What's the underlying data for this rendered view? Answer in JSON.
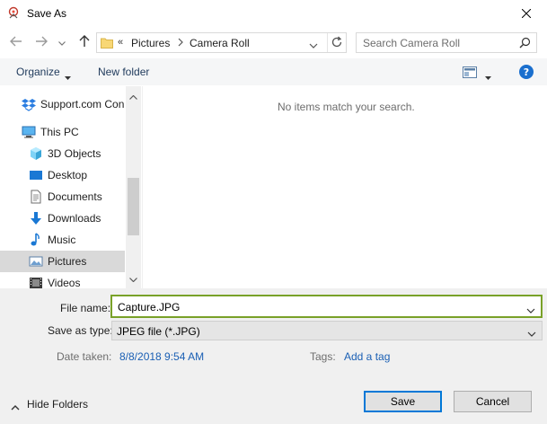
{
  "window": {
    "title": "Save As"
  },
  "address": {
    "overflow": "«",
    "parts": [
      "Pictures",
      "Camera Roll"
    ]
  },
  "search": {
    "placeholder": "Search Camera Roll"
  },
  "commands": {
    "organize": "Organize",
    "new_folder": "New folder"
  },
  "tree": [
    {
      "label": "Support.com Con",
      "icon": "dropbox-icon"
    },
    {
      "label": "This PC",
      "icon": "computer-icon"
    },
    {
      "label": "3D Objects",
      "icon": "cube-icon"
    },
    {
      "label": "Desktop",
      "icon": "desktop-icon"
    },
    {
      "label": "Documents",
      "icon": "document-icon"
    },
    {
      "label": "Downloads",
      "icon": "download-icon"
    },
    {
      "label": "Music",
      "icon": "music-icon"
    },
    {
      "label": "Pictures",
      "icon": "pictures-icon",
      "selected": true
    },
    {
      "label": "Videos",
      "icon": "video-icon"
    }
  ],
  "content": {
    "empty_message": "No items match your search."
  },
  "form": {
    "file_name_label": "File name:",
    "file_name_value": "Capture.JPG",
    "save_type_label": "Save as type:",
    "save_type_value": "JPEG file (*.JPG)",
    "date_taken_label": "Date taken:",
    "date_taken_value": "8/8/2018 9:54 AM",
    "tags_label": "Tags:",
    "tags_value": "Add a tag"
  },
  "footer": {
    "hide_folders": "Hide Folders",
    "save": "Save",
    "cancel": "Cancel"
  },
  "colors": {
    "accent": "#0078d7",
    "filename_border": "#79a128",
    "link": "#1a5fb4"
  }
}
